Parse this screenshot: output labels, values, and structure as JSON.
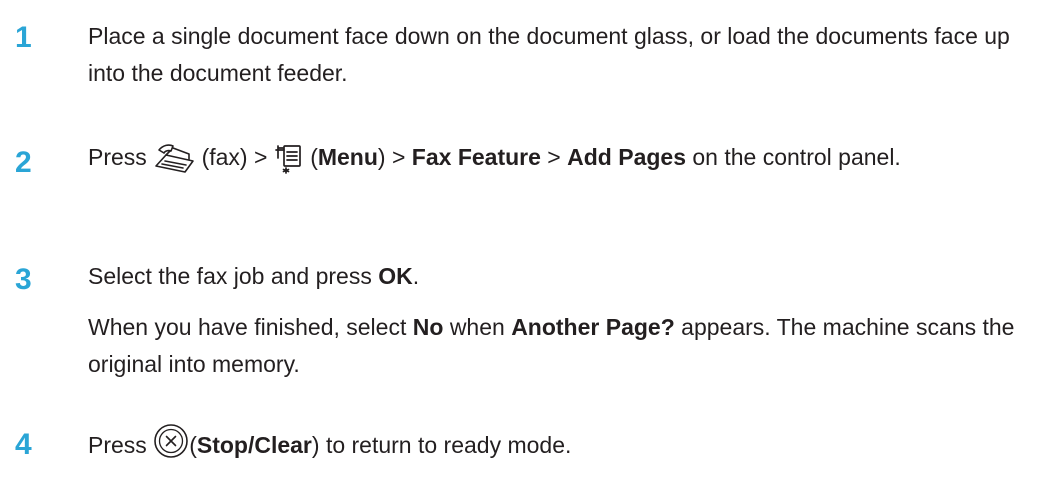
{
  "steps": [
    {
      "number": "1",
      "text": "Place a single document face down on the document glass, or load the documents face up into the document feeder."
    },
    {
      "number": "2",
      "press": "Press",
      "fax_paren": "(fax) >",
      "paren_open": "(",
      "menu": "Menu",
      "paren_close_gt": ") >",
      "fax_feature": "Fax Feature",
      "gt": ">",
      "add_pages": "Add Pages",
      "tail": "on the control panel.",
      "icons": [
        "fax-icon",
        "menu-icon"
      ]
    },
    {
      "number": "3",
      "select": "Select the fax job and press",
      "ok": "OK",
      "period": ".",
      "when": "When you have finished, select",
      "no": "No",
      "when2": "when",
      "another": "Another Page?",
      "appears": "appears. The machine scans the original into memory."
    },
    {
      "number": "4",
      "press": "Press",
      "paren_open": "(",
      "stop": "Stop/Clear",
      "tail": ") to return to ready mode.",
      "icons": [
        "stop-clear-icon"
      ]
    }
  ],
  "colors": {
    "step_number": "#2aa5d6",
    "text": "#231f20"
  }
}
